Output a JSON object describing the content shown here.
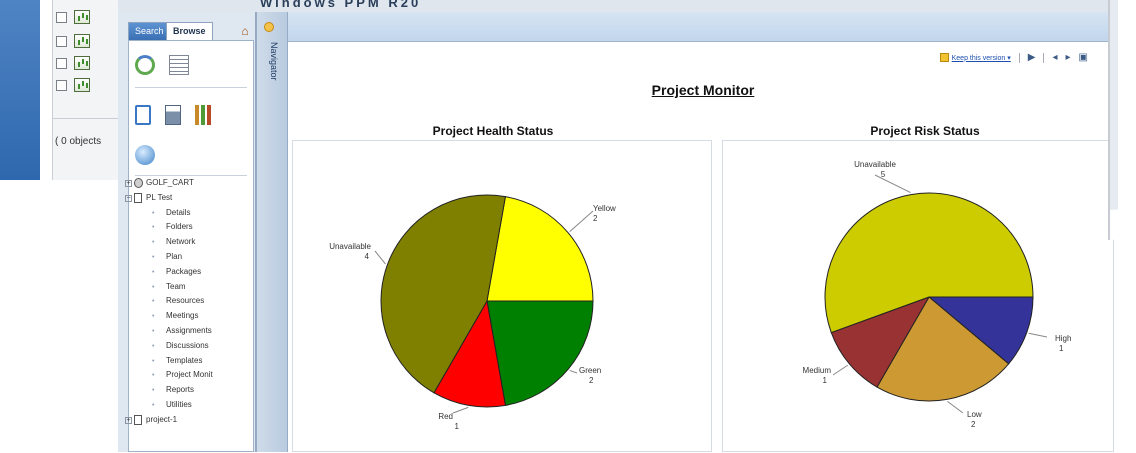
{
  "window_title": "Windows PPM R20",
  "background_window": {
    "object_count": "( 0 objects"
  },
  "explorer": {
    "tabs": [
      {
        "label": "Search"
      },
      {
        "label": "Browse"
      }
    ],
    "tree": [
      {
        "label": "GOLF_CART",
        "level": 0,
        "type": "category",
        "expander": "+"
      },
      {
        "label": "PL Test",
        "level": 0,
        "type": "project",
        "expander": "−"
      },
      {
        "label": "Details",
        "level": 1
      },
      {
        "label": "Folders",
        "level": 1
      },
      {
        "label": "Network",
        "level": 1
      },
      {
        "label": "Plan",
        "level": 1
      },
      {
        "label": "Packages",
        "level": 1
      },
      {
        "label": "Team",
        "level": 1
      },
      {
        "label": "Resources",
        "level": 1
      },
      {
        "label": "Meetings",
        "level": 1
      },
      {
        "label": "Assignments",
        "level": 1
      },
      {
        "label": "Discussions",
        "level": 1
      },
      {
        "label": "Templates",
        "level": 1
      },
      {
        "label": "Project Monit",
        "level": 1
      },
      {
        "label": "Reports",
        "level": 1
      },
      {
        "label": "Utilities",
        "level": 1
      },
      {
        "label": "project-1",
        "level": 0,
        "type": "project",
        "expander": "+"
      }
    ]
  },
  "navigator": {
    "label": "Navigator"
  },
  "toolbar": {
    "keep_version_label": "Keep this version ▾"
  },
  "report": {
    "title": "Project Monitor"
  },
  "chart_data": [
    {
      "type": "pie",
      "title": "Project Health Status",
      "slices": [
        {
          "label": "Yellow",
          "value": 2,
          "color": "#ffff00"
        },
        {
          "label": "Green",
          "value": 2,
          "color": "#008000"
        },
        {
          "label": "Red",
          "value": 1,
          "color": "#ff0000"
        },
        {
          "label": "Unavailable",
          "value": 4,
          "color": "#808000"
        }
      ]
    },
    {
      "type": "pie",
      "title": "Project Risk Status",
      "slices": [
        {
          "label": "High",
          "value": 1,
          "color": "#333399"
        },
        {
          "label": "Low",
          "value": 2,
          "color": "#cc9933"
        },
        {
          "label": "Medium",
          "value": 1,
          "color": "#993333"
        },
        {
          "label": "Unavailable",
          "value": 5,
          "color": "#cccc00"
        }
      ]
    }
  ],
  "colors": {
    "accent": "#3a6fb4",
    "panel_bg": "#dfe7f1"
  }
}
